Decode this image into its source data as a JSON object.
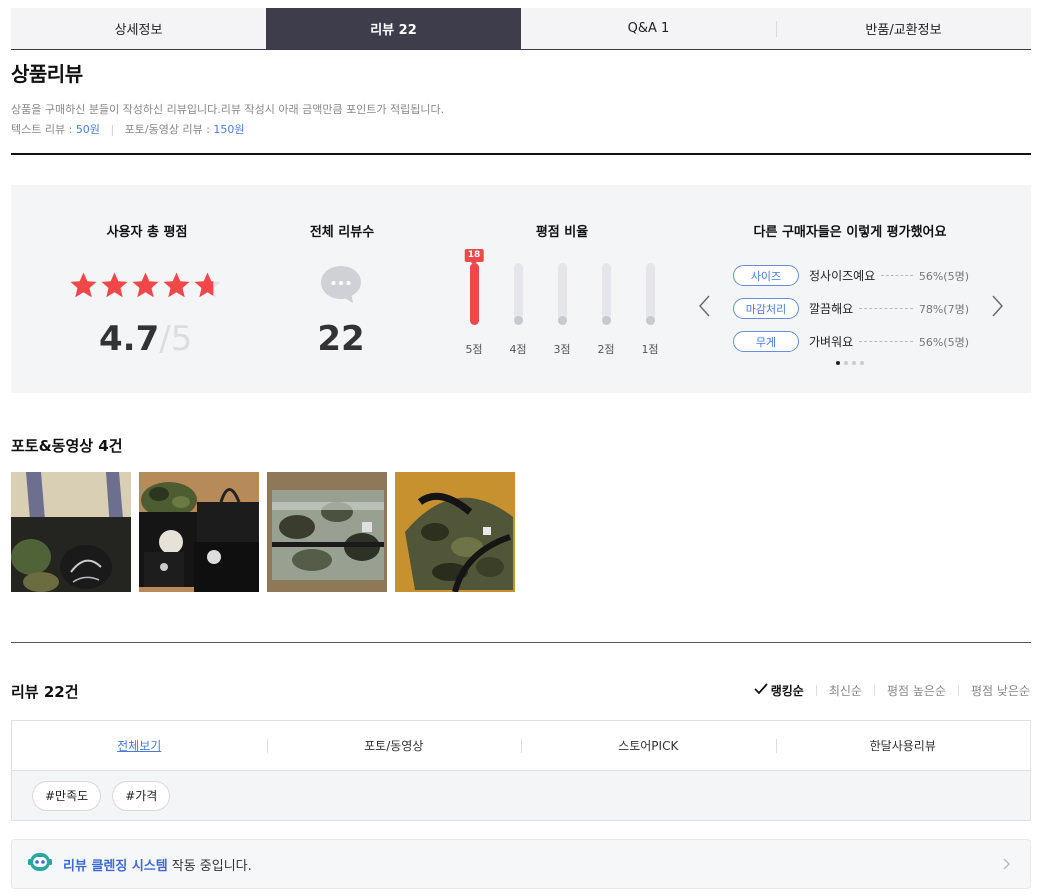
{
  "tabs": [
    {
      "label": "상세정보",
      "active": false
    },
    {
      "label": "리뷰 22",
      "active": true
    },
    {
      "label": "Q&A 1",
      "active": false
    },
    {
      "label": "반품/교환정보",
      "active": false
    }
  ],
  "section": {
    "title": "상품리뷰",
    "description": "상품을 구매하신 분들이 작성하신 리뷰입니다.리뷰 작성시 아래 금액만큼 포인트가 적립됩니다.",
    "text_review_label": "텍스트 리뷰 :",
    "text_review_value": "50원",
    "photo_review_label": "포토/동영상 리뷰 :",
    "photo_review_value": "150원"
  },
  "summary": {
    "rating_label": "사용자 총 평점",
    "rating": "4.7",
    "rating_max": "5",
    "rating_value": 4.7,
    "total_label": "전체 리뷰수",
    "total_count": "22",
    "ratio_label": "평점 비율",
    "ratio": [
      {
        "label": "5점",
        "count": "18",
        "fraction": 1.0
      },
      {
        "label": "4점",
        "count": "",
        "fraction": 0
      },
      {
        "label": "3점",
        "count": "",
        "fraction": 0
      },
      {
        "label": "2점",
        "count": "",
        "fraction": 0
      },
      {
        "label": "1점",
        "count": "",
        "fraction": 0
      }
    ],
    "others_label": "다른 구매자들은 이렇게 평가했어요",
    "evaluations": [
      {
        "tag": "사이즈",
        "text": "정사이즈예요",
        "pct": "56%(5명)"
      },
      {
        "tag": "마감처리",
        "text": "깔끔해요",
        "pct": "78%(7명)"
      },
      {
        "tag": "무게",
        "text": "가벼워요",
        "pct": "56%(5명)"
      }
    ],
    "pager_total": 4,
    "pager_active": 1
  },
  "photos": {
    "title": "포토&동영상 4건",
    "items": [
      "photo-1",
      "photo-2",
      "photo-3",
      "photo-4"
    ]
  },
  "reviews": {
    "title": "리뷰 22건",
    "sort": [
      {
        "label": "랭킹순",
        "active": true
      },
      {
        "label": "최신순",
        "active": false
      },
      {
        "label": "평점 높은순",
        "active": false
      },
      {
        "label": "평점 낮은순",
        "active": false
      }
    ],
    "filter_tabs": [
      {
        "label": "전체보기",
        "active": true
      },
      {
        "label": "포토/동영상",
        "active": false
      },
      {
        "label": "스토어PICK",
        "active": false
      },
      {
        "label": "한달사용리뷰",
        "active": false
      }
    ],
    "tags": [
      "#만족도",
      "#가격"
    ]
  },
  "cleansing": {
    "highlight": "리뷰 클렌징 시스템",
    "rest": "작동 중입니다."
  },
  "colors": {
    "accent": "#4a7bdc",
    "star": "#f04848",
    "tab_active": "#3e3d4c"
  }
}
